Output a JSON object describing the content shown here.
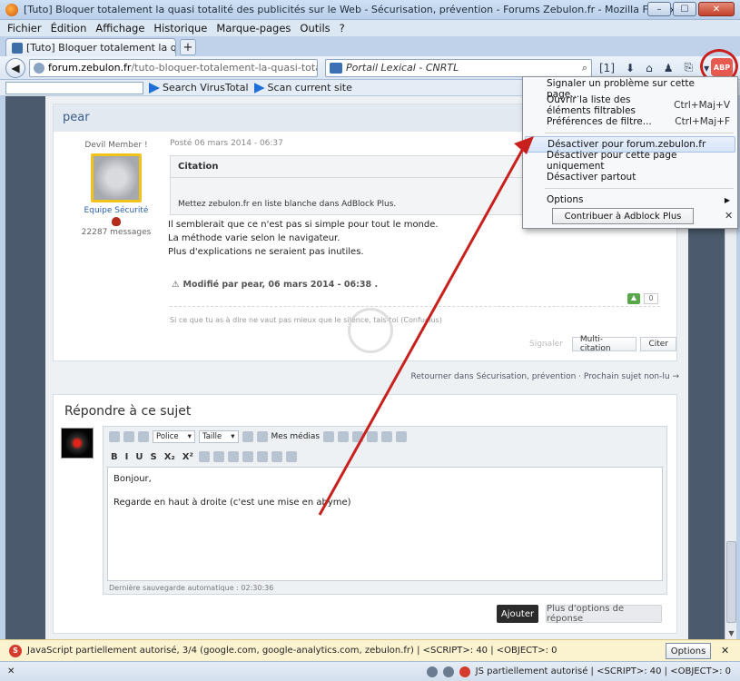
{
  "window": {
    "title": "[Tuto] Bloquer totalement la quasi totalité des publicités sur le Web - Sécurisation, prévention - Forums Zebulon.fr - Mozilla Firefox",
    "buttons": [
      "–",
      "☐",
      "✕"
    ]
  },
  "menu": [
    "Fichier",
    "Édition",
    "Affichage",
    "Historique",
    "Marque-pages",
    "Outils",
    "?"
  ],
  "tab": {
    "title": "[Tuto] Bloquer totalement la quasi totali...",
    "new_tab": "+"
  },
  "nav": {
    "url_host": "forum.zebulon.fr",
    "url_path": "/tuto-bloquer-totalement-la-quasi-totalit",
    "search_placeholder": "Portail Lexical - CNRTL",
    "badge": "[1]",
    "abp_label": "ABP"
  },
  "toolbar2": {
    "virustotal": "Search VirusTotal",
    "scan": "Scan current site"
  },
  "post": {
    "author_name": "pear",
    "rank": "Devil Member !",
    "team": "Equipe Sécurité",
    "messages": "22287 messages",
    "date": "Posté 06 mars 2014 - 06:37",
    "quote_header": "Citation",
    "quote_text": "Mettez zebulon.fr en liste blanche dans AdBlock Plus.",
    "lines": [
      "Il semblerait que ce n'est pas si simple pour tout le monde.",
      "La méthode varie selon le navigateur.",
      "Plus d'explications ne seraient pas inutiles."
    ],
    "modified": "Modifié par pear, 06 mars 2014 - 06:38 .",
    "signature": "Si ce que tu as à dire ne vaut pas mieux que le silence, tais-toi (Confucius)",
    "vote_count": "0",
    "report": "Signaler",
    "multi_quote": "Multi-citation",
    "quote_btn": "Citer"
  },
  "return_line": "Retourner dans Sécurisation, prévention · Prochain sujet non-lu →",
  "reply": {
    "title": "Répondre à ce sujet",
    "font_select": "Police",
    "size_select": "Taille",
    "media": "Mes médias",
    "format_buttons": [
      "B",
      "I",
      "U",
      "S",
      "X₂",
      "X²"
    ],
    "text_lines": [
      "Bonjour,",
      "Regarde en haut à droite (c'est une mise en abyme)"
    ],
    "autosave": "Dernière sauvegarde automatique : 02:30:36",
    "submit": "Ajouter",
    "more_options": "Plus d'options de réponse"
  },
  "abp_menu": {
    "items": [
      {
        "label": "Signaler un problème sur cette page...",
        "shortcut": ""
      },
      {
        "label": "Ouvrir la liste des éléments filtrables",
        "shortcut": "Ctrl+Maj+V"
      },
      {
        "label": "Préférences de filtre...",
        "shortcut": "Ctrl+Maj+F"
      }
    ],
    "disable_items": [
      "Désactiver pour forum.zebulon.fr",
      "Désactiver pour cette page uniquement",
      "Désactiver partout"
    ],
    "options": "Options",
    "contribute": "Contribuer à Adblock Plus",
    "close": "✕"
  },
  "notification": {
    "text": "JavaScript partiellement autorisé, 3/4 (google.com, google-analytics.com, zebulon.fr) | <SCRIPT>: 40 | <OBJECT>: 0",
    "options": "Options",
    "close": "✕"
  },
  "statusbar": {
    "close": "✕",
    "right_text": "JS partiellement autorisé | <SCRIPT>: 40 | <OBJECT>: 0"
  },
  "colors": {
    "arrow": "#c8201c",
    "abp": "#e85a4f",
    "link_blue": "#2a5fb0"
  }
}
